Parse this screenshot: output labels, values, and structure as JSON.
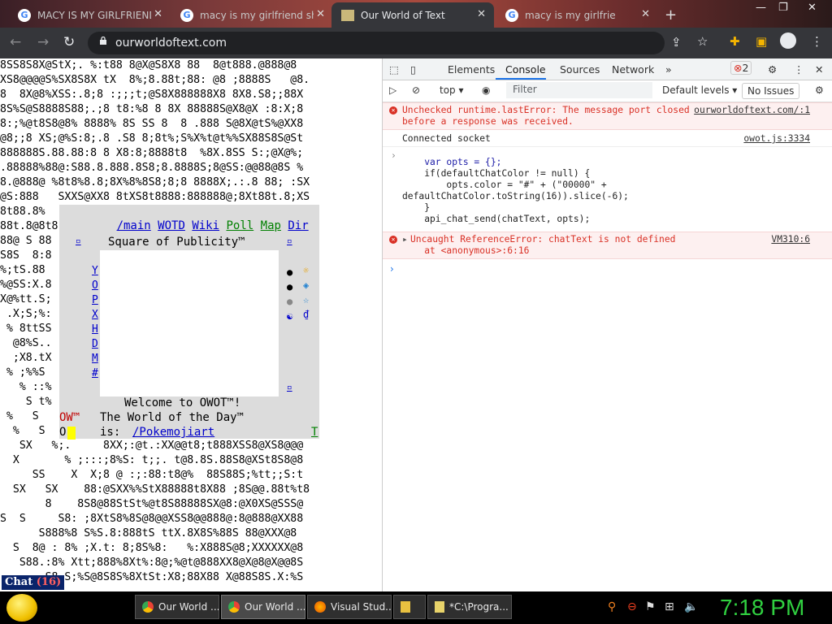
{
  "browser": {
    "tabs": [
      {
        "title": "MACY IS MY GIRLFRIEND",
        "icon": "google-icon",
        "active": false
      },
      {
        "title": "macy is my girlfriend she",
        "icon": "google-icon",
        "active": false
      },
      {
        "title": "Our World of Text",
        "icon": "owot-icon",
        "active": true
      },
      {
        "title": "macy is my girlfrie",
        "icon": "google-icon",
        "active": false
      }
    ],
    "new_tab": "+",
    "url": "ourworldoftext.com"
  },
  "owot": {
    "nav": [
      "/main",
      "WOTD",
      "Wiki",
      "Poll",
      "Map",
      "Dir"
    ],
    "square_title": "Square of Publicity™",
    "square_links": [
      "Y",
      "O",
      "P",
      "X",
      "H",
      "D",
      "M",
      "#"
    ],
    "welcome": "Welcome to OWOT™!",
    "wotd_label": "The World of the Day™",
    "wotd_is": "is:",
    "wotd_link": "/Pokemojiart",
    "ow_left": "OW™",
    "ow_o": "O",
    "t_link": "T",
    "chat_label": "Chat",
    "chat_count": "(16)",
    "background_rows": [
      "8SS8S8X@StX;. %:t88 8@X@S8X8 88  8@t888.@888@8",
      "XS8@@@@S%SX8S8X tX  8%;8.88t;88: @8 ;8888S   @8.",
      "8  8X@8%XSS:.8;8 :;;;t;@S8X888888X8 8X8.S8;;88X",
      "8S%S@S8888S88;.;8 t8:%8 8 8X 88888S@X8@X :8:X;8",
      "8:;%@t8S8@8% 8888% 8S SS 8  8 .888 S@8X@tS%@XX8",
      "@8;;8 XS;@%S:8;.8 .S8 8;8t%;S%X%t@t%%SX88S8S@St",
      "888888S.88.88:8 8 X8:8;8888t8  %8X.8SS S:;@X@%;",
      ".88888%88@:S88.8.888.8S8;8.8888S;8@SS:@@88@8S %",
      "8.@888@ %8t8%8.8;8X%8%8S8;8;8 8888X;.:.8 88; :SX",
      "@S:888   SXXS@XX8 8tXS8t8888:888888@;8Xt88t.8;XS",
      "8t88.8%",
      "88t.8@8t8",
      "88@ S 88",
      "S8S  8:8",
      "%;tS.88",
      "%@SS:X.8",
      "X@%tt.S;",
      " .X;S;%:",
      " % 8ttSS",
      "  @8%S..",
      "  ;X8.tX",
      " % ;%%S",
      "   % ::%",
      "    S t%",
      " %   S  ",
      "  %   S ",
      "   SX   %;.     8XX;:@t.:XX@@t8;t888XSS8@XS8@@@",
      "  X       % ;:::;8%S: t;;. t@8.8S.88S8@XSt8S8@8",
      "     SS    X  X;8 @ :;:88:t8@%  88S88S;%tt;;S:t",
      "  SX   SX    88:@SXX%%StX88888t8X88 ;8S@@.88t%t8",
      "       8    8S8@88StSt%@t8S88888SX@8:@X0XS@SSS@",
      "S  S     S8: ;8XtS8%8S@8@@XSS8@@888@:8@888@XX88",
      "      S888%8 S%S.8:888tS ttX.8X8S%88S 88@XXX@8",
      "  S  8@ : 8% ;X.t: 8;8S%8:   %:X888S@8;XXXXXX@8",
      "   S88.:8% Xtt;888%8Xt%:8@;%@t@888XX8@X@8@X@@8S",
      "       S8.S;%S@8S8S%8XtSt:X8;88X88 X@88S8S.X:%S"
    ]
  },
  "devtools": {
    "tabs": [
      "Elements",
      "Console",
      "Sources",
      "Network"
    ],
    "more": "»",
    "error_count": "2",
    "context": "top",
    "filter_placeholder": "Filter",
    "levels": "Default levels",
    "issues": "No Issues",
    "messages": {
      "error1_text": "Unchecked runtime.lastError: The message port closed",
      "error1_text2": "before a response was received.",
      "error1_src": "ourworldoftext.com/:1",
      "info_text": "Connected socket",
      "info_src": "owot.js:3334",
      "code_lines": [
        "    var opts = {};",
        "    if(defaultChatColor != null) {",
        "        opts.color = \"#\" + (\"00000\" +",
        "defaultChatColor.toString(16)).slice(-6);",
        "    }",
        "    api_chat_send(chatText, opts);"
      ],
      "error2_text": "Uncaught ReferenceError: chatText is not defined",
      "error2_sub": "    at <anonymous>:6:16",
      "error2_src": "VM310:6"
    }
  },
  "taskbar": {
    "buttons": [
      {
        "label": "Our World ...",
        "icon": "chrome-icon"
      },
      {
        "label": "Our World ...",
        "icon": "chrome-icon"
      },
      {
        "label": "Visual Stud...",
        "icon": "firefox-icon"
      },
      {
        "label": "",
        "icon": "folder-icon"
      },
      {
        "label": "*C:\\Progra...",
        "icon": "notepad-icon"
      }
    ],
    "clock": "7:18 PM"
  }
}
